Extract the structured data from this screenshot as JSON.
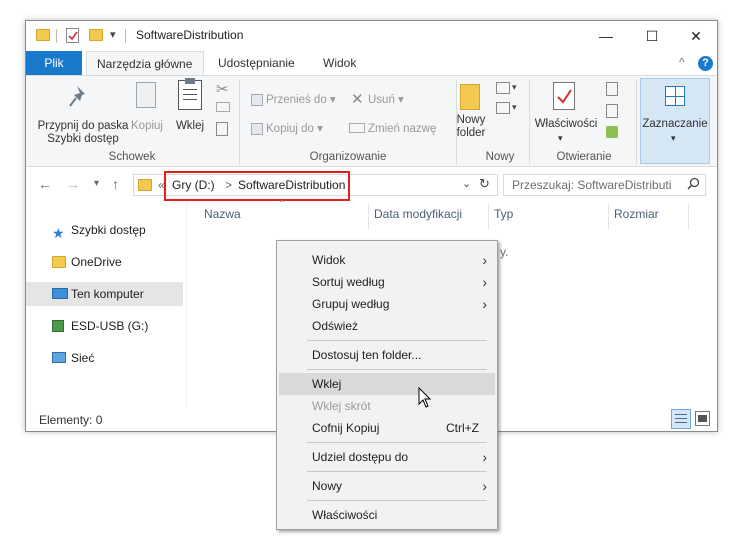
{
  "window": {
    "title": "SoftwareDistribution",
    "minimize_glyph": "—",
    "maximize_glyph": "☐",
    "close_glyph": "✕"
  },
  "tabs": {
    "file": "Plik",
    "home": "Narzędzia główne",
    "share": "Udostępnianie",
    "view": "Widok",
    "collapse_glyph": "^",
    "help_glyph": "?"
  },
  "ribbon": {
    "clipboard": {
      "group_label": "Schowek",
      "pin": "Przypnij do paska\nSzybki dostęp",
      "copy": "Kopiuj",
      "paste": "Wklej"
    },
    "organize": {
      "group_label": "Organizowanie",
      "move_to": "Przenieś do",
      "copy_to": "Kopiuj do",
      "delete": "Usuń",
      "rename": "Zmień nazwę"
    },
    "new": {
      "group_label": "Nowy",
      "new_folder": "Nowy\nfolder"
    },
    "open": {
      "group_label": "Otwieranie",
      "properties": "Właściwości"
    },
    "select": {
      "label": "Zaznaczanie"
    }
  },
  "address": {
    "chevrons": "«",
    "drive": "Gry (D:)",
    "separator": ">",
    "folder": "SoftwareDistribution",
    "search_placeholder": "Przeszukaj: SoftwareDistributi"
  },
  "nav_pane": {
    "items": [
      {
        "label": "Szybki dostęp",
        "icon": "star-icon"
      },
      {
        "label": "OneDrive",
        "icon": "folder-icon"
      },
      {
        "label": "Ten komputer",
        "icon": "computer-icon"
      },
      {
        "label": "ESD-USB (G:)",
        "icon": "usb-drive-icon"
      },
      {
        "label": "Sieć",
        "icon": "network-icon"
      }
    ]
  },
  "columns": [
    "Nazwa",
    "Data modyfikacji",
    "Typ",
    "Rozmiar"
  ],
  "empty_fragment": "y.",
  "status": {
    "items_count": "Elementy: 0"
  },
  "context_menu": {
    "view": "Widok",
    "sort_by": "Sortuj według",
    "group_by": "Grupuj według",
    "refresh": "Odśwież",
    "customize": "Dostosuj ten folder...",
    "paste": "Wklej",
    "paste_shortcut": "Wklej skrót",
    "undo_copy": "Cofnij Kopiuj",
    "undo_shortcut": "Ctrl+Z",
    "share_with": "Udziel dostępu do",
    "new": "Nowy",
    "properties": "Właściwości"
  },
  "colors": {
    "accent": "#1979ca",
    "highlight_box": "#e0201a"
  }
}
